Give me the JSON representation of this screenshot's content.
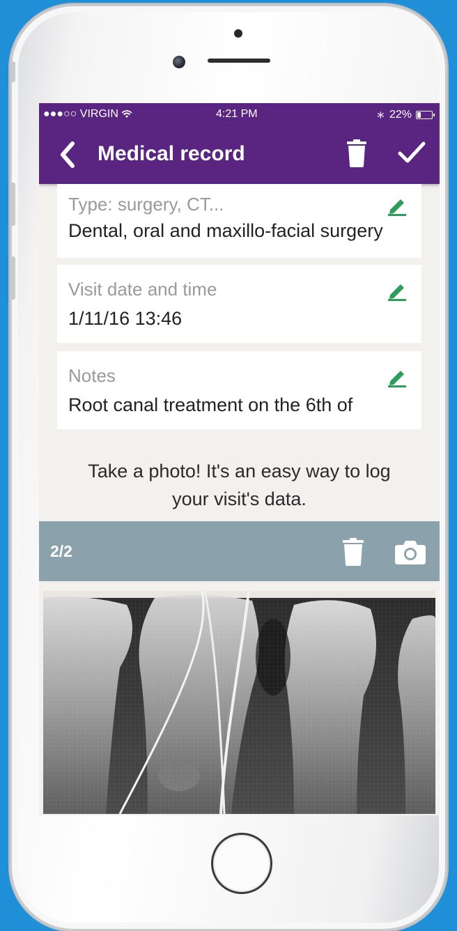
{
  "status_bar": {
    "carrier": "●●●○○ VIRGIN",
    "time": "4:21 PM",
    "battery": "22%"
  },
  "app_bar": {
    "title": "Medical record"
  },
  "fields": [
    {
      "label": "Type: surgery, CT...",
      "value": "Dental, oral and maxillo-facial surgery"
    },
    {
      "label": "Visit date and time",
      "value": "1/11/16 13:46"
    },
    {
      "label": "Notes",
      "value": "Root canal treatment on the  6th of"
    }
  ],
  "prompt": {
    "line1": "Take a photo! It's an easy way to log",
    "line2": "your visit's data."
  },
  "gallery": {
    "counter": "2/2"
  },
  "colors": {
    "primary": "#5a2581",
    "accent": "#2e9c5a",
    "gallery_bar": "#8ba2ad",
    "background": "#1f8fd8"
  },
  "icons": [
    "back-arrow-icon",
    "trash-icon",
    "checkmark-icon",
    "pencil-icon",
    "camera-icon"
  ]
}
